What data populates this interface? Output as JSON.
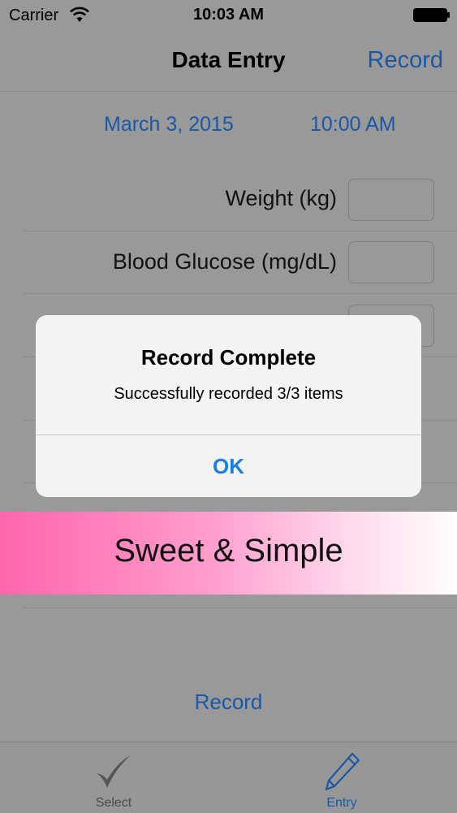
{
  "status_bar": {
    "carrier": "Carrier",
    "time": "10:03 AM",
    "wifi_icon": "wifi-icon",
    "battery_icon": "battery-icon"
  },
  "nav_bar": {
    "title": "Data Entry",
    "record_label": "Record"
  },
  "entry": {
    "date": "March 3, 2015",
    "time": "10:00 AM",
    "fields": [
      {
        "label": "Weight (kg)",
        "value": ""
      },
      {
        "label": "Blood Glucose (mg/dL)",
        "value": ""
      },
      {
        "label": "",
        "value": ""
      }
    ],
    "record_button": "Record"
  },
  "banner": {
    "text": "Sweet & Simple"
  },
  "alert": {
    "title": "Record Complete",
    "message": "Successfully recorded 3/3 items",
    "ok_label": "OK"
  },
  "tab_bar": {
    "tabs": [
      {
        "label": "Select",
        "icon": "checkmark-icon",
        "selected": false
      },
      {
        "label": "Entry",
        "icon": "pencil-icon",
        "selected": true
      }
    ]
  },
  "colors": {
    "link_blue": "#1a58a6",
    "alert_button_blue": "#1a7de0",
    "dimmed_background": "#999999",
    "banner_pink": "#ff66aa"
  }
}
